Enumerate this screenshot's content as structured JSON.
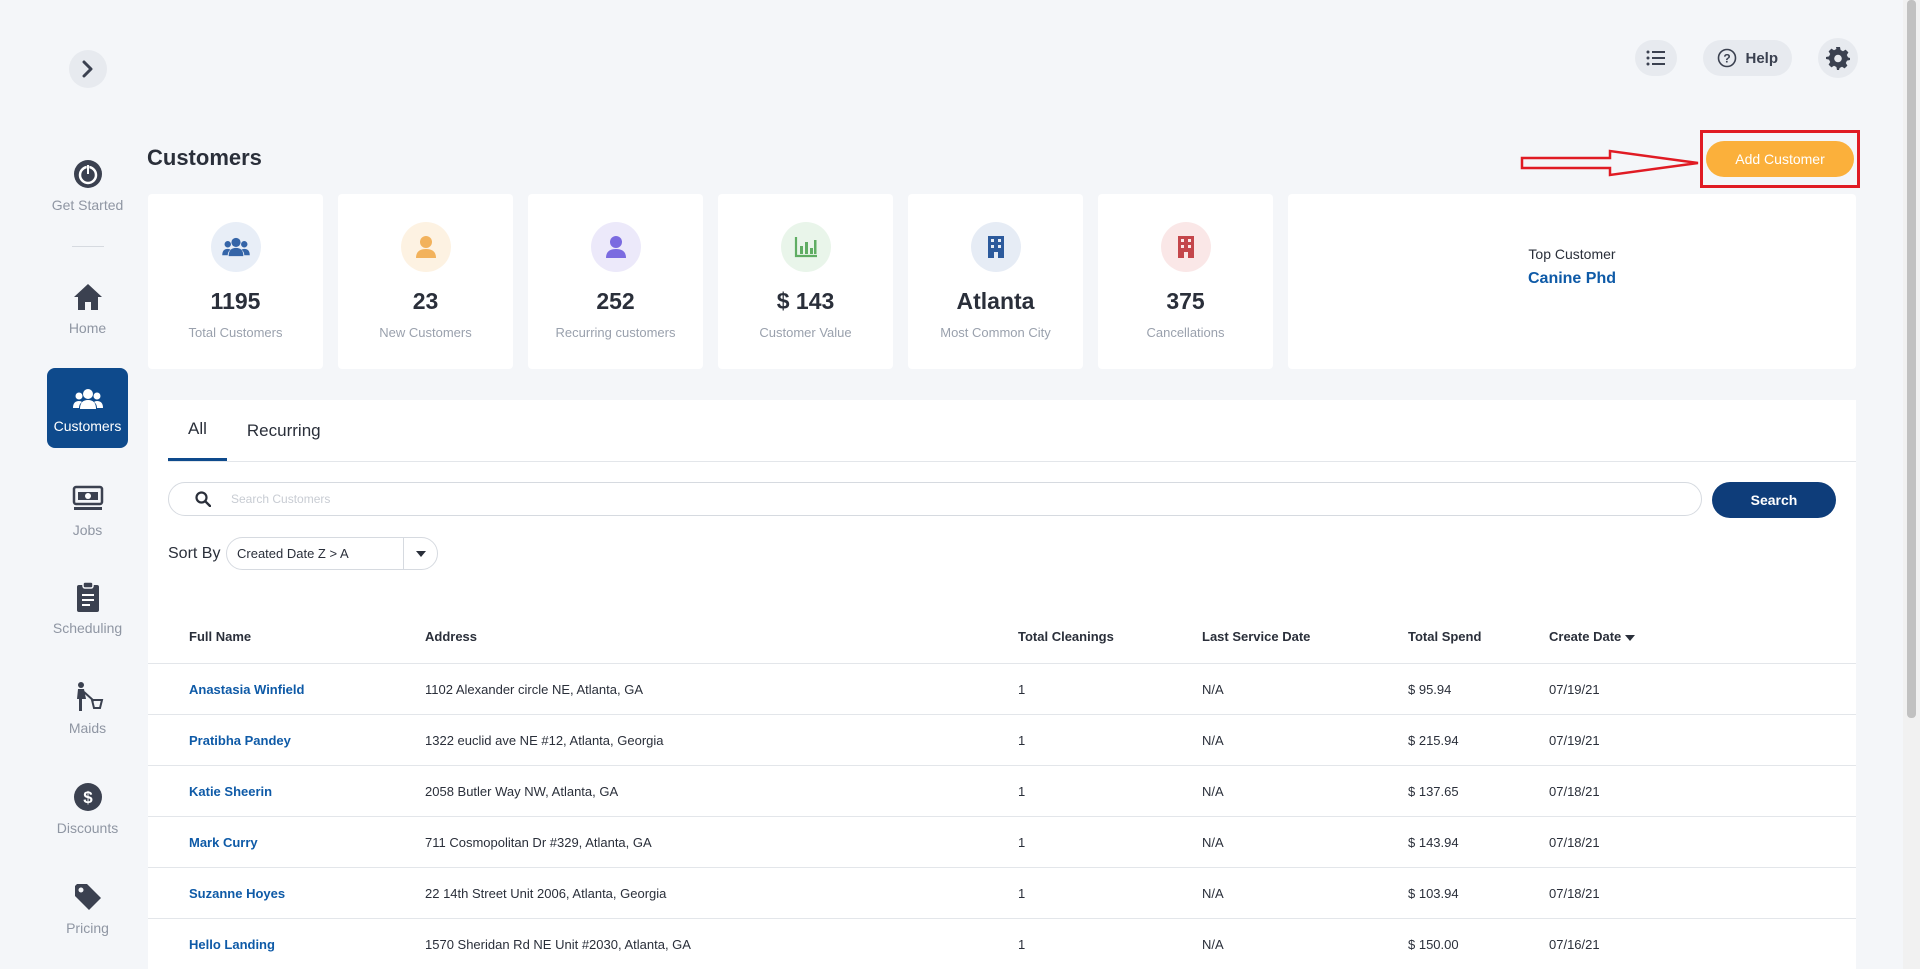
{
  "sidebar": {
    "items": [
      {
        "label": "Get Started",
        "icon": "power-icon"
      },
      {
        "label": "Home",
        "icon": "home-icon"
      },
      {
        "label": "Customers",
        "icon": "users-icon"
      },
      {
        "label": "Jobs",
        "icon": "jobs-icon"
      },
      {
        "label": "Scheduling",
        "icon": "clipboard-icon"
      },
      {
        "label": "Maids",
        "icon": "maid-icon"
      },
      {
        "label": "Discounts",
        "icon": "dollar-icon"
      },
      {
        "label": "Pricing",
        "icon": "tag-icon"
      }
    ],
    "active": "Customers"
  },
  "header": {
    "help_label": "Help",
    "page_title": "Customers",
    "add_button": "Add Customer"
  },
  "stats": [
    {
      "value": "1195",
      "label": "Total Customers",
      "icon": "users-icon",
      "bg": "#e8eef7",
      "color": "#3565a8"
    },
    {
      "value": "23",
      "label": "New Customers",
      "icon": "user-icon",
      "bg": "#fdf2e2",
      "color": "#f2b25c"
    },
    {
      "value": "252",
      "label": "Recurring customers",
      "icon": "user-icon",
      "bg": "#ece9fa",
      "color": "#7b6be0"
    },
    {
      "value": "$ 143",
      "label": "Customer Value",
      "icon": "chart-icon",
      "bg": "#e9f5ea",
      "color": "#5fad63"
    },
    {
      "value": "Atlanta",
      "label": "Most Common City",
      "icon": "building-icon",
      "bg": "#e6ecf5",
      "color": "#2c5a9c"
    },
    {
      "value": "375",
      "label": "Cancellations",
      "icon": "building-icon",
      "bg": "#fae7e7",
      "color": "#c4464b"
    }
  ],
  "top_customer": {
    "label": "Top Customer",
    "value": "Canine Phd"
  },
  "tabs": [
    "All",
    "Recurring"
  ],
  "search": {
    "placeholder": "Search Customers",
    "button": "Search"
  },
  "sort": {
    "label": "Sort By",
    "value": "Created Date Z > A"
  },
  "table": {
    "headers": [
      "Full Name",
      "Address",
      "Total Cleanings",
      "Last Service Date",
      "Total Spend",
      "Create Date"
    ],
    "rows": [
      [
        "Anastasia Winfield",
        "1102 Alexander circle NE, Atlanta, GA",
        "1",
        "N/A",
        "$ 95.94",
        "07/19/21"
      ],
      [
        "Pratibha Pandey",
        "1322 euclid ave NE #12, Atlanta, Georgia",
        "1",
        "N/A",
        "$ 215.94",
        "07/19/21"
      ],
      [
        "Katie Sheerin",
        "2058 Butler Way NW, Atlanta, GA",
        "1",
        "N/A",
        "$ 137.65",
        "07/18/21"
      ],
      [
        "Mark Curry",
        "711 Cosmopolitan Dr #329, Atlanta, GA",
        "1",
        "N/A",
        "$ 143.94",
        "07/18/21"
      ],
      [
        "Suzanne Hoyes",
        "22 14th Street Unit 2006, Atlanta, Georgia",
        "1",
        "N/A",
        "$ 103.94",
        "07/18/21"
      ],
      [
        "Hello Landing",
        "1570 Sheridan Rd NE Unit #2030, Atlanta, GA",
        "1",
        "N/A",
        "$ 150.00",
        "07/16/21"
      ]
    ]
  },
  "colors": {
    "primary": "#0e4a8c",
    "accent": "#fbb03b",
    "link": "#0e5aa7",
    "highlight": "#e01b24"
  }
}
